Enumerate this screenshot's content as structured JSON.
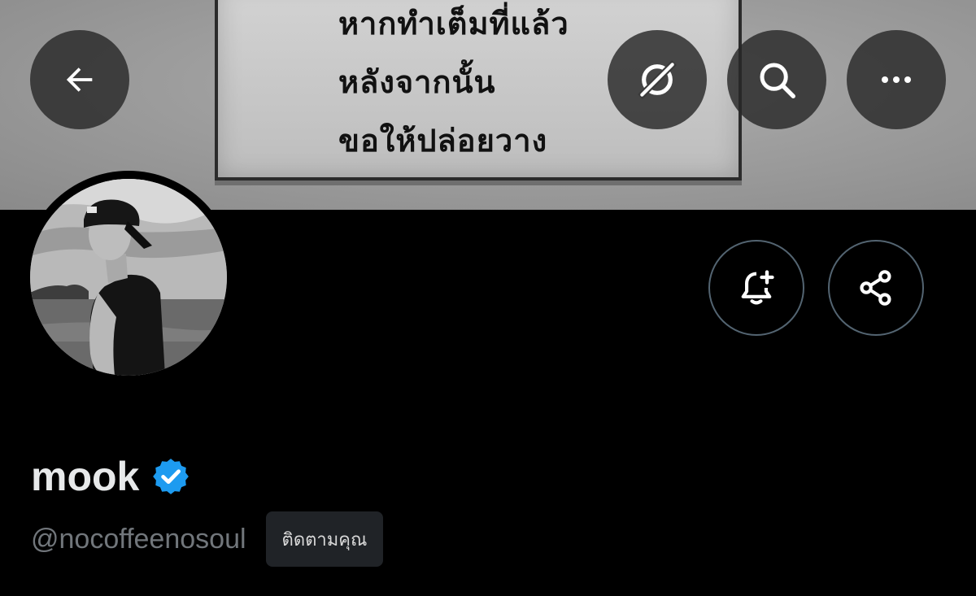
{
  "banner": {
    "sign_lines": [
      "หากทำเต็มที่แล้ว",
      "หลังจากนั้น",
      "ขอให้ปล่อยวาง"
    ]
  },
  "topbar": {
    "back_icon": "arrow-left-icon",
    "grok_icon": "grok-icon",
    "search_icon": "search-icon",
    "more_icon": "more-horizontal-icon"
  },
  "actions": {
    "notify_icon": "bell-plus-icon",
    "share_icon": "share-icon"
  },
  "profile": {
    "display_name": "mook",
    "handle": "@nocoffeenosoul",
    "follows_you_label": "ติดตามคุณ",
    "verified_color": "#1d9bf0"
  },
  "colors": {
    "background": "#000000",
    "secondary_text": "#71767b",
    "accent": "#1d9bf0"
  }
}
